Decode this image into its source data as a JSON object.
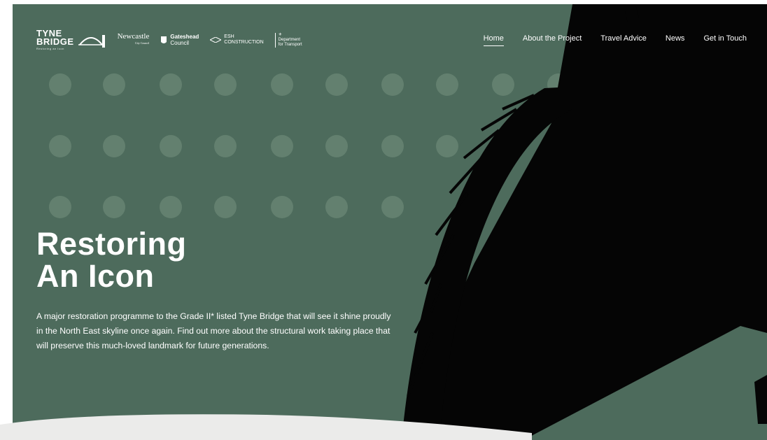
{
  "colors": {
    "hero_bg": "#4d6b5c",
    "dot": "#63806f",
    "bridge": "#050505",
    "text": "#ffffff"
  },
  "logos": {
    "tyne_bridge": {
      "line1": "TYNE",
      "line2": "BRIDGE",
      "tagline": "Restoring an Icon"
    },
    "newcastle": {
      "name": "Newcastle",
      "sub": "City Council"
    },
    "gateshead": {
      "line1": "Gateshead",
      "line2": "Council"
    },
    "esh": {
      "line1": "ESH",
      "line2": "CONSTRUCTION"
    },
    "dft": {
      "line1": "Department",
      "line2": "for Transport"
    }
  },
  "nav": {
    "items": [
      {
        "label": "Home",
        "active": true
      },
      {
        "label": "About the Project"
      },
      {
        "label": "Travel Advice"
      },
      {
        "label": "News"
      },
      {
        "label": "Get in Touch"
      }
    ]
  },
  "hero": {
    "title_line1": "Restoring",
    "title_line2": "An Icon",
    "description": "A major restoration programme to the Grade II* listed Tyne Bridge that will see it shine proudly in the North East skyline once again. Find out more about the structural work taking place that will preserve this much-loved landmark for future generations."
  }
}
